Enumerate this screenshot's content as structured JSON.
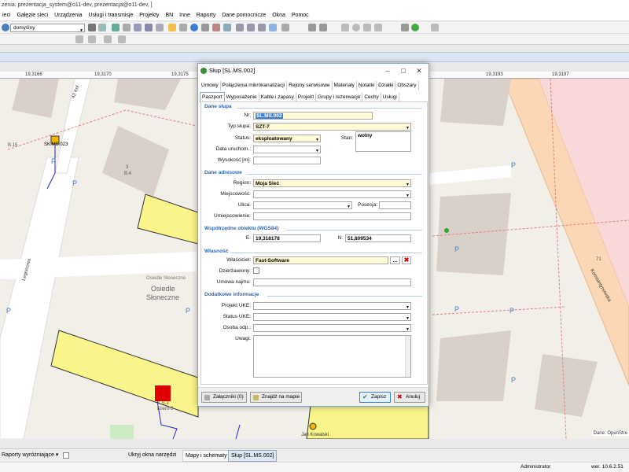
{
  "window_title": "zenia: prezentacja_system@o11-dev, prezentacja@o11-dev, ]",
  "menu": [
    "ieci",
    "Gałęzie sieci",
    "Urządzenia",
    "Usługi i transmisje",
    "Projekty",
    "BN",
    "Inne",
    "Raporty",
    "Dane pomocnicze",
    "Okna",
    "Pomoc"
  ],
  "toolbar": {
    "style_combo": "domyślny"
  },
  "ruler": [
    "19,3166",
    "19,3170",
    "19,3175",
    "19,3193",
    "19,3197"
  ],
  "map": {
    "labels": {
      "street_42": "42 Kol",
      "b_label": "B.15",
      "sk_label": "SK.MS.023",
      "building_3": "3",
      "building_b4": "B.4",
      "parking_p": "P",
      "osiedle_small": "Osiedle Słoneczne",
      "osiedle_big_1": "Osiedle",
      "osiedle_big_2": "Słoneczne",
      "legnicowa": "Legnicowa",
      "konstantynowska": "Konstantynowska",
      "num_71": "71",
      "klient": "Klient-3",
      "jan": "Jan Kowalski",
      "ks": "K.S.1"
    },
    "credit": "Dane: OpenStre"
  },
  "dialog": {
    "title": "Słup [SL.MS.002]",
    "tabs_row1": [
      "Umowy",
      "Połączenia mikrokanalizacji",
      "Rejony serwisowe",
      "Materiały",
      "Notatki",
      "Działki",
      "Obszary"
    ],
    "tabs_row2": [
      "Paszport",
      "Wyposażenie",
      "Kable i zapasy",
      "Projekt",
      "Grupy i rezerwacje",
      "Cechy",
      "Usługi"
    ],
    "sections": {
      "dane_slupa": "Dane słupa",
      "dane_adresowe": "Dane adresowe",
      "wspolrzedne": "Współrzędne obiektu (WGS84)",
      "wlasnosc": "Własność",
      "dodatkowe": "Dodatkowe informacje"
    },
    "labels": {
      "nr": "Nr:",
      "typ": "Typ słupa:",
      "status": "Status:",
      "stan": "Stan:",
      "data": "Data uruchom.:",
      "wysokosc": "Wysokość [m]:",
      "region": "Region:",
      "miejscowosc": "Miejscowość:",
      "ulica": "Ulica:",
      "posesja": "Posesja:",
      "umiejscowienie": "Umiejscowienie:",
      "e": "E:",
      "n": "N:",
      "wlasciciel": "Właściciel:",
      "dzierzawiony": "Dzierżawiony:",
      "umowa": "Umowa najmu:",
      "projekt_uke": "Projekt UKE:",
      "status_uke": "Status UKE:",
      "osoba": "Osoba odp.:",
      "uwagi": "Uwagi:"
    },
    "values": {
      "nr": "SL.MS.002",
      "typ": "SZT-7",
      "status": "eksploatowany",
      "stan": "wolny",
      "region": "Moja Sieć",
      "e": "19,318178",
      "n": "51,809534",
      "wlasciciel": "Fast-Software"
    },
    "footer": {
      "zalaczniki": "Załączniki (0)",
      "znajdz": "Znajdź na mapie",
      "zapisz": "Zapisz",
      "anuluj": "Anuluj"
    }
  },
  "statusbar": {
    "raporty": "Raporty wyróżniające",
    "ukryj": "Ukryj okna narzędzi",
    "tab1": "Mapy i schematy",
    "tab2": "Słup [SL.MS.002]",
    "user": "Administrator",
    "version": "wer. 10.6.2.51"
  },
  "colors": {
    "accent": "#2a66b5",
    "required_field": "#fff9d5",
    "building": "#f9f58b",
    "red_marker": "#e00000"
  }
}
